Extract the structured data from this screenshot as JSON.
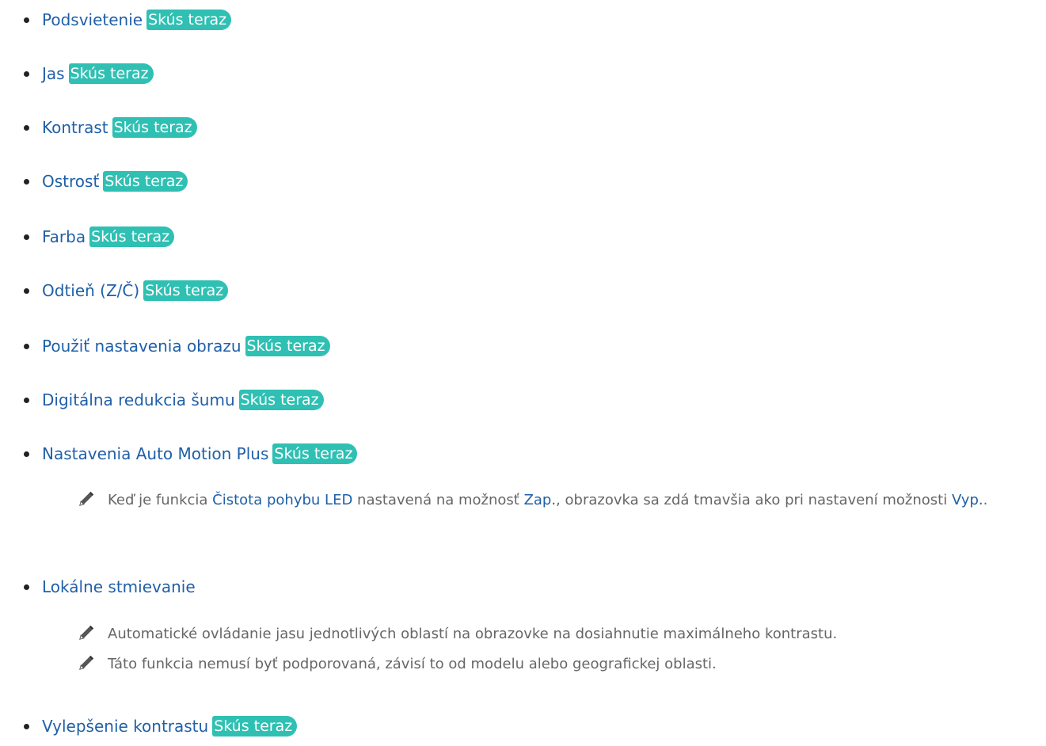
{
  "try_label": "Skús teraz",
  "items": [
    {
      "title": "Podsvietenie"
    },
    {
      "title": "Jas"
    },
    {
      "title": "Kontrast"
    },
    {
      "title": "Ostrosť"
    },
    {
      "title": "Farba"
    },
    {
      "title": "Odtieň (Z/Č)"
    },
    {
      "title": "Použiť nastavenia obrazu"
    },
    {
      "title": "Digitálna redukcia šumu"
    },
    {
      "title": "Nastavenia Auto Motion Plus"
    },
    {
      "title": "Lokálne stmievanie"
    },
    {
      "title": "Vylepšenie kontrastu"
    }
  ],
  "notes": {
    "motion": {
      "part1": "Keď je funkcia ",
      "hl1": "Čistota pohybu LED",
      "part2": " nastavená na možnosť ",
      "hl2": "Zap.",
      "part3": ", obrazovka sa zdá tmavšia ako pri nastavení možnosti ",
      "hl3": "Vyp.",
      "part4": "."
    },
    "dimming_1": "Automatické ovládanie jasu jednotlivých oblastí na obrazovke na dosiahnutie maximálneho kontrastu.",
    "dimming_2": "Táto funkcia nemusí byť podporovaná, závisí to od modelu alebo geografickej oblasti."
  },
  "icon_names": {
    "note": "pencil-icon"
  },
  "colors": {
    "link": "#1f5fa8",
    "badge": "#2fc0b3",
    "note_text": "#666666"
  }
}
